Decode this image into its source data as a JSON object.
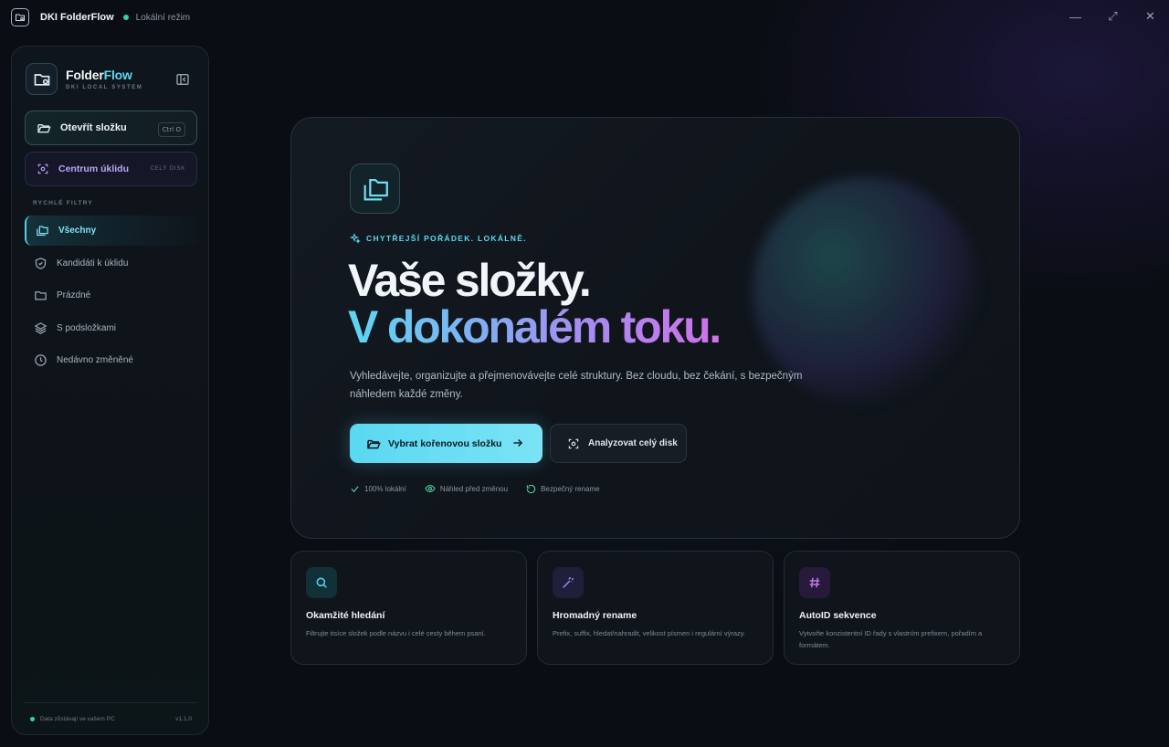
{
  "titlebar": {
    "app_title": "DKI FolderFlow",
    "mode": "Lokální režim",
    "controls": {
      "minimize": "—",
      "maximize": "⤢",
      "close": "✕"
    }
  },
  "sidebar": {
    "brand_name_a": "Folder",
    "brand_name_b": "Flow",
    "brand_sub": "DKI LOCAL SYSTEM",
    "open_button": {
      "label": "Otevřít složku",
      "shortcut": "Ctrl O"
    },
    "cleanup_button": {
      "label": "Centrum úklidu",
      "tag": "CELÝ DISK"
    },
    "section_label": "RYCHLÉ FILTRY",
    "nav": [
      {
        "label": "Všechny",
        "icon": "folders-icon",
        "active": true
      },
      {
        "label": "Kandidáti k úklidu",
        "icon": "shield-check-icon"
      },
      {
        "label": "Prázdné",
        "icon": "folder-icon"
      },
      {
        "label": "S podsložkami",
        "icon": "layers-icon"
      },
      {
        "label": "Nedávno změněné",
        "icon": "clock-icon"
      }
    ],
    "footer_text": "Data zůstávají ve vašem PC",
    "version": "v1.1.0"
  },
  "hero": {
    "tagline": "CHYTŘEJŠÍ POŘÁDEK. LOKÁLNĚ.",
    "headline_1": "Vaše složky.",
    "headline_2": "V dokonalém toku.",
    "description": "Vyhledávejte, organizujte a přejmenovávejte celé struktury. Bez cloudu, bez čekání, s bezpečným náhledem každé změny.",
    "primary_button": "Vybrat kořenovou složku",
    "secondary_button": "Analyzovat celý disk",
    "badges": [
      "100% lokální",
      "Náhled před změnou",
      "Bezpečný rename"
    ]
  },
  "features": [
    {
      "title": "Okamžité hledání",
      "desc": "Filtrujte tisíce složek podle názvu i celé cesty během psaní.",
      "icon": "search-icon",
      "color": "#4fd1e8"
    },
    {
      "title": "Hromadný rename",
      "desc": "Prefix, suffix, hledat/nahradit, velikost písmen i regulární výrazy.",
      "icon": "magic-wand-icon",
      "color": "#9b8cf0"
    },
    {
      "title": "AutoID sekvence",
      "desc": "Vytvořte konzistentní ID řady s vlastním prefixem, pořadím a formátem.",
      "icon": "hash-icon",
      "color": "#c07ae8"
    }
  ],
  "colors": {
    "accent": "#5ad8f2",
    "purple": "#a88af0",
    "pink": "#d072e8",
    "online": "#34d399"
  }
}
